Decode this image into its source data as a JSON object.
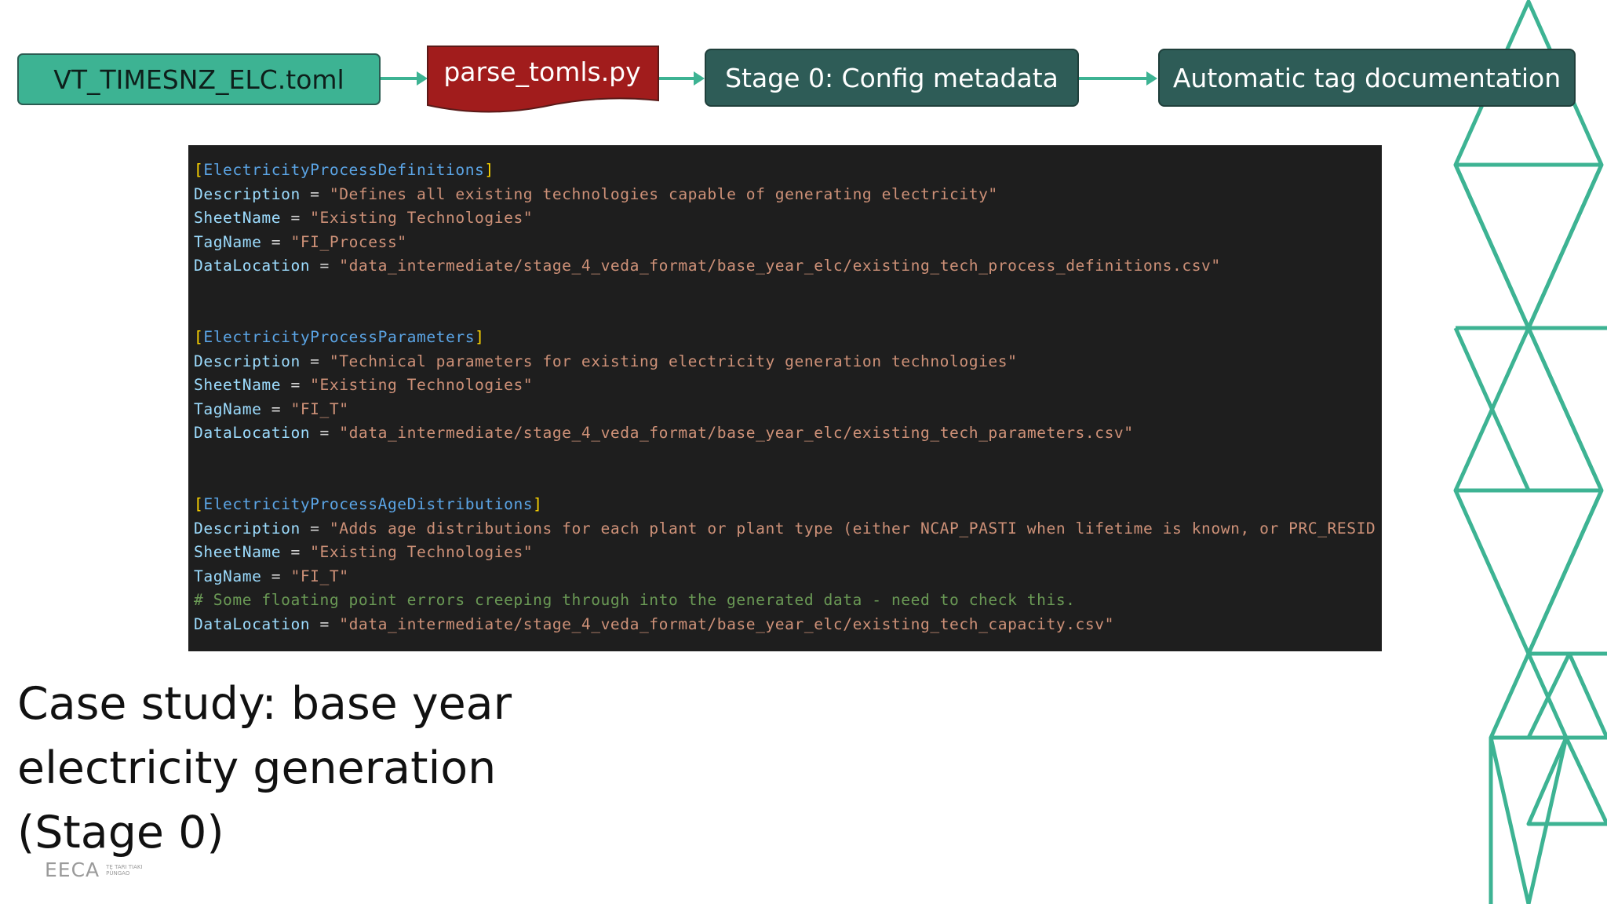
{
  "flow": {
    "step1": "VT_TIMESNZ_ELC.toml",
    "step2": "parse_tomls.py",
    "step3": "Stage 0: Config metadata",
    "step4": "Automatic tag documentation"
  },
  "code": {
    "sections": [
      {
        "header": "ElectricityProcessDefinitions",
        "lines": [
          {
            "key": "Description",
            "value": "\"Defines all existing technologies capable of generating electricity\""
          },
          {
            "key": "SheetName",
            "value": "\"Existing Technologies\""
          },
          {
            "key": "TagName",
            "value": "\"FI_Process\""
          },
          {
            "key": "DataLocation",
            "value": "\"data_intermediate/stage_4_veda_format/base_year_elc/existing_tech_process_definitions.csv\""
          }
        ]
      },
      {
        "header": "ElectricityProcessParameters",
        "lines": [
          {
            "key": "Description",
            "value": "\"Technical parameters for existing electricity generation technologies\""
          },
          {
            "key": "SheetName",
            "value": "\"Existing Technologies\""
          },
          {
            "key": "TagName",
            "value": "\"FI_T\""
          },
          {
            "key": "DataLocation",
            "value": "\"data_intermediate/stage_4_veda_format/base_year_elc/existing_tech_parameters.csv\""
          }
        ]
      },
      {
        "header": "ElectricityProcessAgeDistributions",
        "lines": [
          {
            "key": "Description",
            "value": "\"Adds age distributions for each plant or plant type (either NCAP_PASTI when lifetime is known, or PRC_RESID"
          },
          {
            "key": "SheetName",
            "value": "\"Existing Technologies\""
          },
          {
            "key": "TagName",
            "value": "\"FI_T\""
          },
          {
            "comment": "# Some floating point errors creeping through into the generated data - need to check this."
          },
          {
            "key": "DataLocation",
            "value": "\"data_intermediate/stage_4_veda_format/base_year_elc/existing_tech_capacity.csv\""
          }
        ]
      }
    ]
  },
  "title": {
    "line1": "Case study: base year",
    "line2": "electricity generation",
    "line3": "(Stage 0)"
  },
  "logo": {
    "mark": "EECA",
    "tagline": "TE TARI TIAKI PŪNGAO"
  },
  "colors": {
    "accent_green": "#3db393",
    "script_red": "#a11c1c",
    "stage_teal": "#2e5c57",
    "code_bg": "#1e1e1e"
  }
}
